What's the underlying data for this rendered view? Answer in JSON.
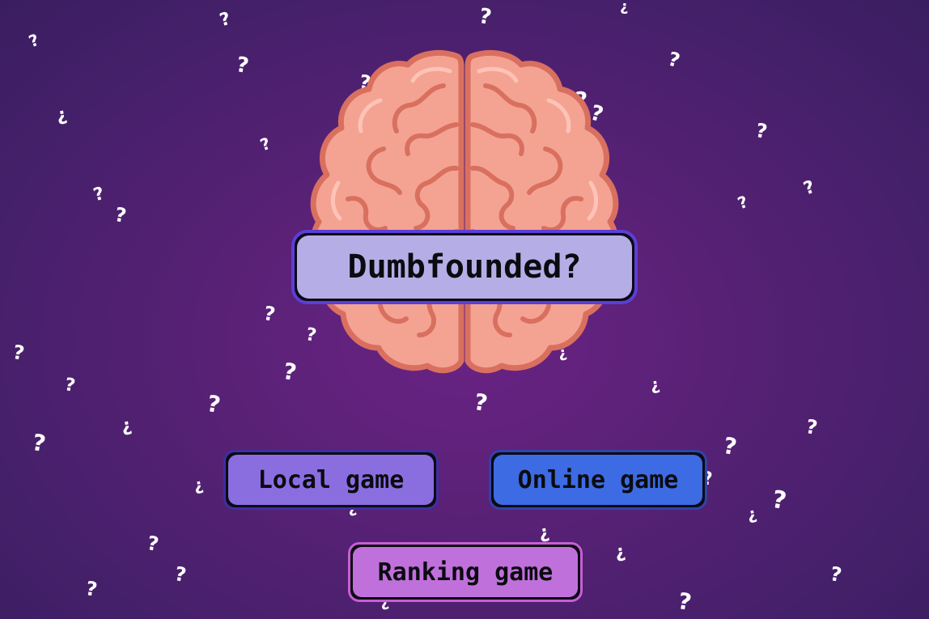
{
  "title": "Dumbfounded?",
  "menu": {
    "local_label": "Local game",
    "online_label": "Online game",
    "ranking_label": "Ranking game"
  },
  "colors": {
    "background": "#5a2177",
    "title_fill": "#b5aee6",
    "title_border": "#5b3fd6",
    "local_button": "#8a6ee0",
    "online_button": "#3d6be3",
    "ranking_button": "#c070db",
    "brain_fill": "#f4a393",
    "brain_outline": "#d9705f"
  },
  "icons": {
    "brain": "brain-icon",
    "decoration": "question-mark-icon"
  }
}
